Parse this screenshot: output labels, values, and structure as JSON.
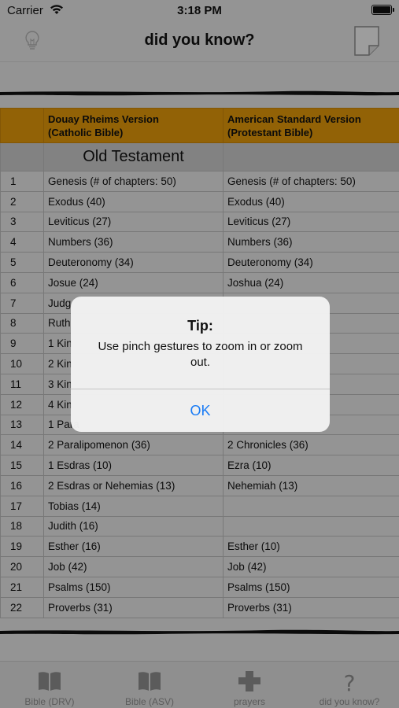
{
  "status_bar": {
    "carrier": "Carrier",
    "time": "3:18 PM"
  },
  "nav": {
    "title": "did you know?",
    "left_icon": "lightbulb-icon",
    "right_icon": "note-page-icon"
  },
  "table": {
    "headers": [
      "",
      "Douay Rheims Version\n(Catholic Bible)",
      "American Standard Version\n(Protestant Bible)"
    ],
    "header_drv_line1": "Douay Rheims Version",
    "header_drv_line2": "(Catholic Bible)",
    "header_asv_line1": "American Standard Version",
    "header_asv_line2": "(Protestant Bible)",
    "section": "Old Testament",
    "rows": [
      {
        "num": "1",
        "drv": "Genesis (# of chapters: 50)",
        "asv": "Genesis (# of chapters: 50)"
      },
      {
        "num": "2",
        "drv": "Exodus (40)",
        "asv": "Exodus (40)"
      },
      {
        "num": "3",
        "drv": "Leviticus (27)",
        "asv": "Leviticus (27)"
      },
      {
        "num": "4",
        "drv": "Numbers (36)",
        "asv": "Numbers (36)"
      },
      {
        "num": "5",
        "drv": "Deuteronomy (34)",
        "asv": "Deuteronomy (34)"
      },
      {
        "num": "6",
        "drv": "Josue (24)",
        "asv": "Joshua (24)"
      },
      {
        "num": "7",
        "drv": "Judg",
        "asv": ""
      },
      {
        "num": "8",
        "drv": "Ruth",
        "asv": ""
      },
      {
        "num": "9",
        "drv": "1 Kin",
        "asv": ""
      },
      {
        "num": "10",
        "drv": "2 Kin",
        "asv": ""
      },
      {
        "num": "11",
        "drv": "3 Kin",
        "asv": ""
      },
      {
        "num": "12",
        "drv": "4 Kin",
        "asv": ""
      },
      {
        "num": "13",
        "drv": "1 Para",
        "asv": ""
      },
      {
        "num": "14",
        "drv": "2 Paralipomenon (36)",
        "asv": "2 Chronicles (36)"
      },
      {
        "num": "15",
        "drv": "1 Esdras (10)",
        "asv": "Ezra (10)"
      },
      {
        "num": "16",
        "drv": "2 Esdras or Nehemias (13)",
        "asv": "Nehemiah (13)"
      },
      {
        "num": "17",
        "drv": "Tobias (14)",
        "asv": ""
      },
      {
        "num": "18",
        "drv": "Judith (16)",
        "asv": ""
      },
      {
        "num": "19",
        "drv": "Esther (16)",
        "asv": "Esther (10)"
      },
      {
        "num": "20",
        "drv": "Job (42)",
        "asv": "Job (42)"
      },
      {
        "num": "21",
        "drv": "Psalms (150)",
        "asv": "Psalms (150)"
      },
      {
        "num": "22",
        "drv": "Proverbs (31)",
        "asv": "Proverbs (31)"
      }
    ]
  },
  "tabs": [
    {
      "label": "Bible (DRV)",
      "icon": "open-book-icon"
    },
    {
      "label": "Bible (ASV)",
      "icon": "open-book-icon"
    },
    {
      "label": "prayers",
      "icon": "plus-icon"
    },
    {
      "label": "did you know?",
      "icon": "question-mark-icon"
    }
  ],
  "alert": {
    "title": "Tip:",
    "message": "Use pinch gestures to zoom in or zoom out.",
    "button": "OK"
  },
  "colors": {
    "header_bg": "#e0970a",
    "section_bg": "#c8c8c8",
    "page_bg": "#e3e3e3",
    "alert_button": "#1a7cf5",
    "tab_inactive": "#8d8d8d"
  }
}
